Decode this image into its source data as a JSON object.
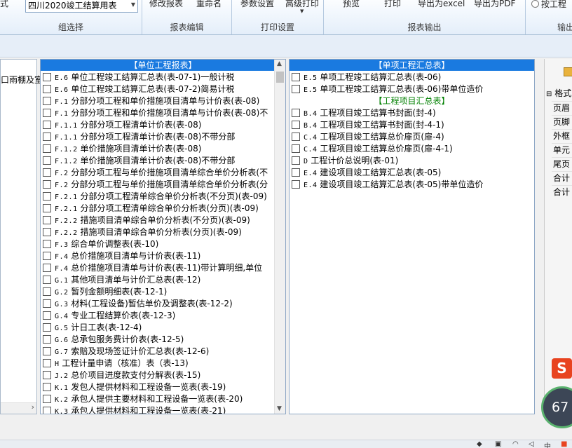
{
  "ribbon": {
    "group_select": {
      "combo_value": "四川2020竣工结算用表",
      "left_cut_label": "式",
      "label": "组选择"
    },
    "group_edit": {
      "buttons": [
        "修改报表",
        "重命名"
      ],
      "label": "报表编辑"
    },
    "group_print": {
      "buttons": [
        "参数设置",
        "高级打印"
      ],
      "label": "打印设置"
    },
    "group_export": {
      "buttons": [
        "预览",
        "打印",
        "导出为excel",
        "导出为PDF"
      ],
      "label": "报表输出"
    },
    "group_output": {
      "radio_label": "按工程",
      "label": "输出"
    }
  },
  "left_panel": {
    "item": "口雨棚及室"
  },
  "unit_panel": {
    "title": "【单位工程报表】",
    "items": [
      {
        "code": "E.6",
        "name": "单位工程竣工结算汇总表(表-07-1)一般计税"
      },
      {
        "code": "E.6",
        "name": "单位工程竣工结算汇总表(表-07-2)简易计税"
      },
      {
        "code": "F.1",
        "name": "分部分项工程和单价措施项目清单与计价表(表-08)"
      },
      {
        "code": "F.1",
        "name": "分部分项工程和单价措施项目清单与计价表(表-08)不"
      },
      {
        "code": "F.1.1",
        "name": "分部分项工程清单计价表(表-08)"
      },
      {
        "code": "F.1.1",
        "name": "分部分项工程清单计价表(表-08)不带分部"
      },
      {
        "code": "F.1.2",
        "name": "单价措施项目清单计价表(表-08)"
      },
      {
        "code": "F.1.2",
        "name": "单价措施项目清单计价表(表-08)不带分部"
      },
      {
        "code": "F.2",
        "name": "分部分项工程与单价措施项目清单综合单价分析表(不"
      },
      {
        "code": "F.2",
        "name": "分部分项工程与单价措施项目清单综合单价分析表(分"
      },
      {
        "code": "F.2.1",
        "name": "分部分项工程清单综合单价分析表(不分页)(表-09)"
      },
      {
        "code": "F.2.1",
        "name": "分部分项工程清单综合单价分析表(分页)(表-09)"
      },
      {
        "code": "F.2.2",
        "name": "措施项目清单综合单价分析表(不分页)(表-09)"
      },
      {
        "code": "F.2.2",
        "name": "措施项目清单综合单价分析表(分页)(表-09)"
      },
      {
        "code": "F.3",
        "name": "综合单价调整表(表-10)"
      },
      {
        "code": "F.4",
        "name": "总价措施项目清单与计价表(表-11)"
      },
      {
        "code": "F.4",
        "name": "总价措施项目清单与计价表(表-11)带计算明细,单位"
      },
      {
        "code": "G.1",
        "name": "其他项目清单与计价汇总表(表-12)"
      },
      {
        "code": "G.2",
        "name": "暂列金额明细表(表-12-1)"
      },
      {
        "code": "G.3",
        "name": "材料(工程设备)暂估单价及调整表(表-12-2)"
      },
      {
        "code": "G.4",
        "name": "专业工程结算价表(表-12-3)"
      },
      {
        "code": "G.5",
        "name": "计日工表(表-12-4)"
      },
      {
        "code": "G.6",
        "name": "总承包服务费计价表(表-12-5)"
      },
      {
        "code": "G.7",
        "name": "索赔及现场签证计价汇总表(表-12-6)"
      },
      {
        "code": "H",
        "name": "工程计量申请（核准）表（表-13)"
      },
      {
        "code": "J.2",
        "name": "总价项目进度款支付分解表(表-15)"
      },
      {
        "code": "K.1",
        "name": "发包人提供材料和工程设备一览表(表-19)"
      },
      {
        "code": "K.2",
        "name": "承包人提供主要材料和工程设备一览表(表-20)"
      },
      {
        "code": "K.3",
        "name": "承包人提供材料和工程设备一览表(表-21)"
      }
    ]
  },
  "single_panel": {
    "title": "【单项工程汇总表】",
    "items": [
      {
        "code": "E.5",
        "name": "单项工程竣工结算汇总表(表-06)"
      },
      {
        "code": "E.5",
        "name": "单项工程竣工结算汇总表(表-06)带单位造价"
      }
    ],
    "project_title": "【工程项目汇总表】",
    "project_items": [
      {
        "code": "B.4",
        "name": "工程项目竣工结算书封面(封-4)"
      },
      {
        "code": "B.4",
        "name": "工程项目竣工结算书封面(封-4-1)"
      },
      {
        "code": "C.4",
        "name": "工程项目竣工结算总价扉页(扉-4)"
      },
      {
        "code": "C.4",
        "name": "工程项目竣工结算总价扉页(扉-4-1)"
      },
      {
        "code": "D",
        "name": "工程计价总说明(表-01)"
      },
      {
        "code": "E.4",
        "name": "建设项目竣工结算汇总表(表-05)"
      },
      {
        "code": "E.4",
        "name": "建设项目竣工结算汇总表(表-05)带单位造价"
      }
    ]
  },
  "format_panel": {
    "group": "格式",
    "props": [
      "页眉",
      "页脚",
      "外框",
      "单元",
      "尾页",
      "合计",
      "合计"
    ]
  },
  "widgets": {
    "ime_glyph": "S",
    "monitor_value": "67"
  },
  "colors": {
    "panel_header": "#1a7ae0",
    "subheader_text": "#008000"
  }
}
